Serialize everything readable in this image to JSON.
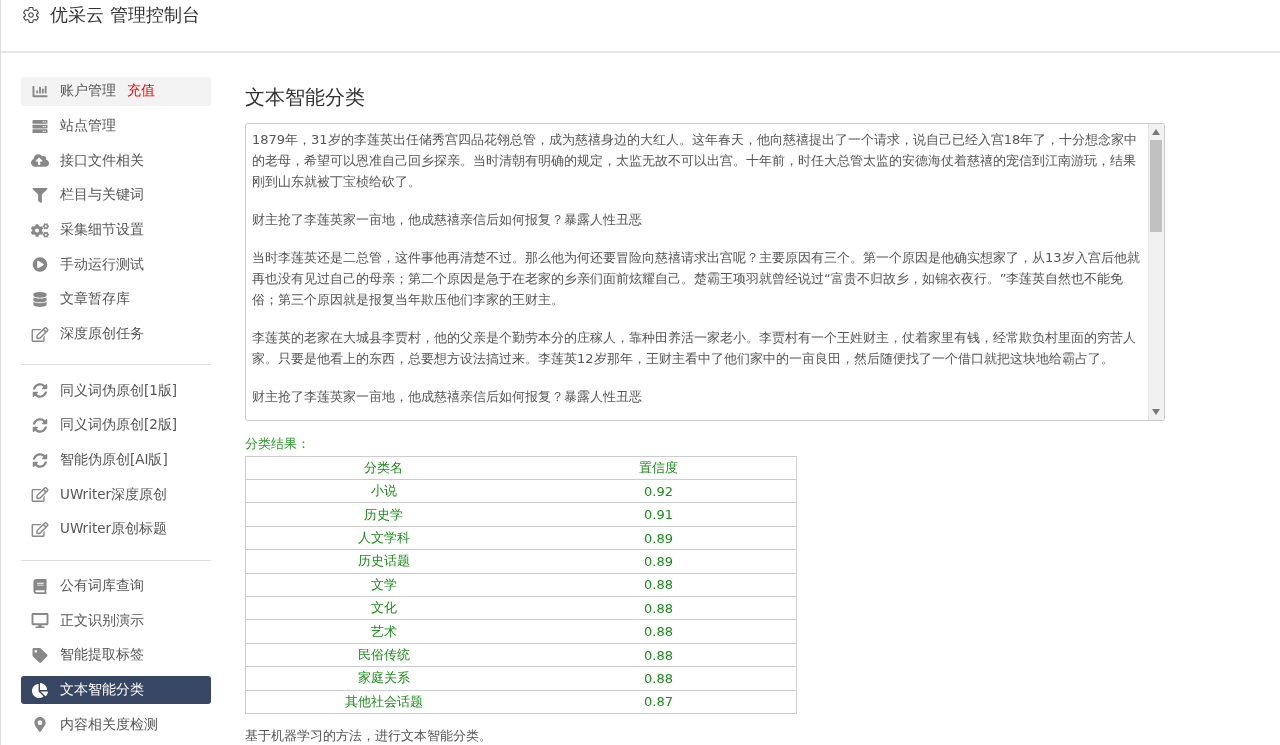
{
  "header": {
    "title": "优采云 管理控制台"
  },
  "sidebar": {
    "groups": [
      {
        "items": [
          {
            "label": "账户管理",
            "badge": "充值",
            "highlighted": true,
            "selected": false
          },
          {
            "label": "站点管理",
            "highlighted": false,
            "selected": false
          },
          {
            "label": "接口文件相关",
            "highlighted": false,
            "selected": false
          },
          {
            "label": "栏目与关键词",
            "highlighted": false,
            "selected": false
          },
          {
            "label": "采集细节设置",
            "highlighted": false,
            "selected": false
          },
          {
            "label": "手动运行测试",
            "highlighted": false,
            "selected": false
          },
          {
            "label": "文章暂存库",
            "highlighted": false,
            "selected": false
          },
          {
            "label": "深度原创任务",
            "highlighted": false,
            "selected": false
          }
        ]
      },
      {
        "items": [
          {
            "label": "同义词伪原创[1版]",
            "highlighted": false,
            "selected": false
          },
          {
            "label": "同义词伪原创[2版]",
            "highlighted": false,
            "selected": false
          },
          {
            "label": "智能伪原创[AI版]",
            "highlighted": false,
            "selected": false
          },
          {
            "label": "UWriter深度原创",
            "highlighted": false,
            "selected": false
          },
          {
            "label": "UWriter原创标题",
            "highlighted": false,
            "selected": false
          }
        ]
      },
      {
        "items": [
          {
            "label": "公有词库查询",
            "highlighted": false,
            "selected": false
          },
          {
            "label": "正文识别演示",
            "highlighted": false,
            "selected": false
          },
          {
            "label": "智能提取标签",
            "highlighted": false,
            "selected": false
          },
          {
            "label": "文本智能分类",
            "highlighted": false,
            "selected": true
          },
          {
            "label": "内容相关度检测",
            "highlighted": false,
            "selected": false
          }
        ]
      }
    ]
  },
  "main": {
    "title": "文本智能分类",
    "article": {
      "paragraphs": [
        "1879年，31岁的李莲英出任储秀宫四品花翎总管，成为慈禧身边的大红人。这年春天，他向慈禧提出了一个请求，说自己已经入宫18年了，十分想念家中的老母，希望可以恩准自己回乡探亲。当时清朝有明确的规定，太监无故不可以出宫。十年前，时任大总管太监的安德海仗着慈禧的宠信到江南游玩，结果刚到山东就被丁宝桢给砍了。",
        "财主抢了李莲英家一亩地，他成慈禧亲信后如何报复？暴露人性丑恶",
        "当时李莲英还是二总管，这件事他再清楚不过。那么他为何还要冒险向慈禧请求出宫呢？主要原因有三个。第一个原因是他确实想家了，从13岁入宫后他就再也没有见过自己的母亲；第二个原因是急于在老家的乡亲们面前炫耀自己。楚霸王项羽就曾经说过“富贵不归故乡，如锦衣夜行。”李莲英自然也不能免俗；第三个原因就是报复当年欺压他们李家的王财主。",
        "李莲英的老家在大城县李贾村，他的父亲是个勤劳本分的庄稼人，靠种田养活一家老小。李贾村有一个王姓财主，仗着家里有钱，经常欺负村里面的穷苦人家。只要是他看上的东西，总要想方设法搞过来。李莲英12岁那年，王财主看中了他们家中的一亩良田，然后随便找了一个借口就把这块地给霸占了。",
        "财主抢了李莲英家一亩地，他成慈禧亲信后如何报复？暴露人性丑恶"
      ]
    },
    "result_label": "分类结果：",
    "table": {
      "columns": [
        "分类名",
        "置信度"
      ],
      "rows": [
        [
          "小说",
          "0.92"
        ],
        [
          "历史学",
          "0.91"
        ],
        [
          "人文学科",
          "0.89"
        ],
        [
          "历史话题",
          "0.89"
        ],
        [
          "文学",
          "0.88"
        ],
        [
          "文化",
          "0.88"
        ],
        [
          "艺术",
          "0.88"
        ],
        [
          "民俗传统",
          "0.88"
        ],
        [
          "家庭关系",
          "0.88"
        ],
        [
          "其他社会话题",
          "0.87"
        ]
      ]
    },
    "footnote": "基于机器学习的方法，进行文本智能分类。"
  }
}
